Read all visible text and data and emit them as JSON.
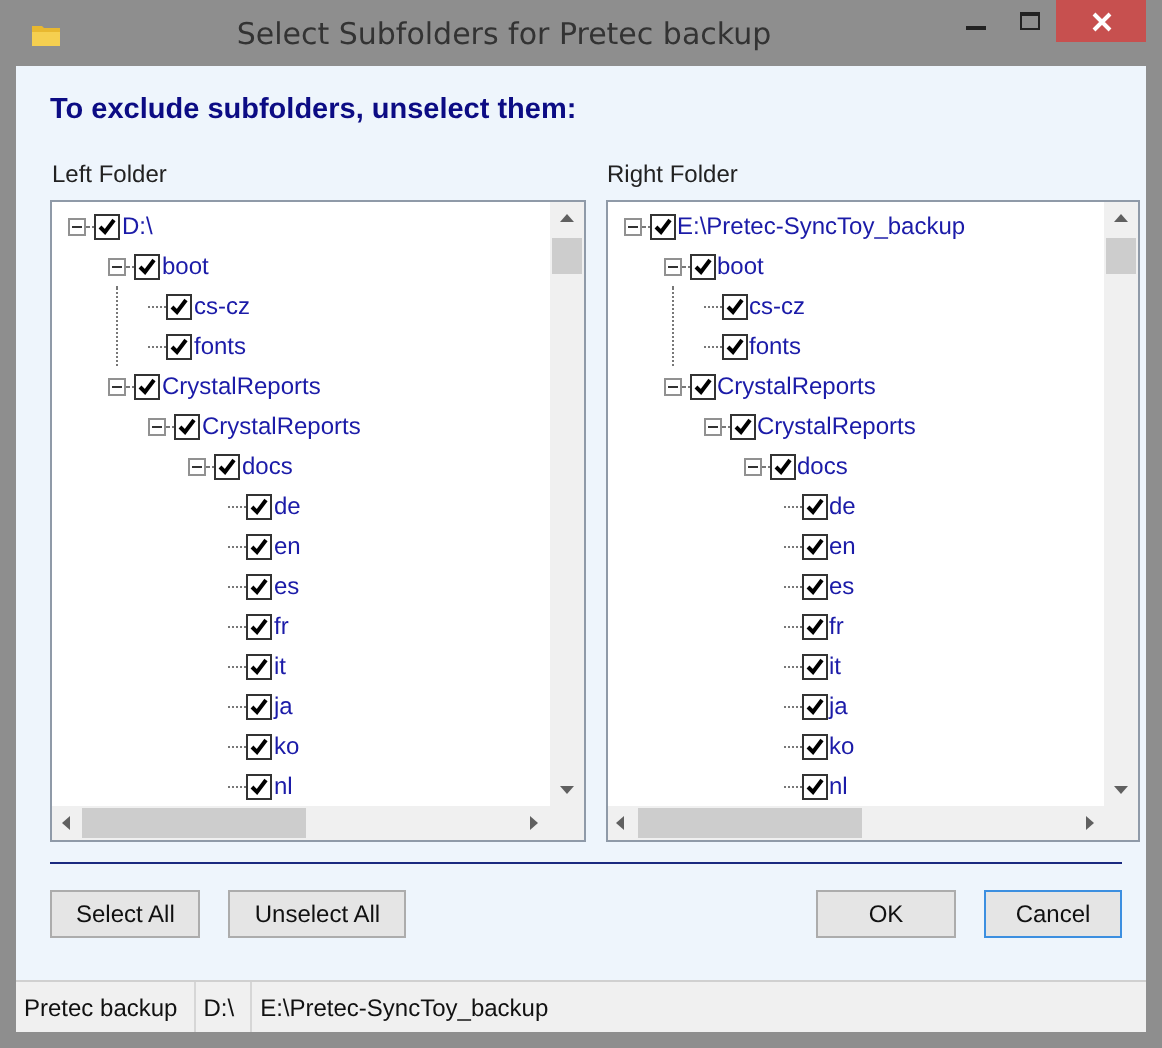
{
  "window": {
    "title": "Select Subfolders for Pretec backup"
  },
  "instruction": "To exclude subfolders, unselect them:",
  "panels": [
    {
      "label": "Left Folder",
      "tree": [
        {
          "name": "D:\\",
          "checked": true,
          "expanded": true,
          "children": [
            {
              "name": "boot",
              "checked": true,
              "expanded": true,
              "children": [
                {
                  "name": "cs-cz",
                  "checked": true
                },
                {
                  "name": "fonts",
                  "checked": true
                }
              ]
            },
            {
              "name": "CrystalReports",
              "checked": true,
              "expanded": true,
              "children": [
                {
                  "name": "CrystalReports",
                  "checked": true,
                  "expanded": true,
                  "children": [
                    {
                      "name": "docs",
                      "checked": true,
                      "expanded": true,
                      "children": [
                        {
                          "name": "de",
                          "checked": true
                        },
                        {
                          "name": "en",
                          "checked": true
                        },
                        {
                          "name": "es",
                          "checked": true
                        },
                        {
                          "name": "fr",
                          "checked": true
                        },
                        {
                          "name": "it",
                          "checked": true
                        },
                        {
                          "name": "ja",
                          "checked": true
                        },
                        {
                          "name": "ko",
                          "checked": true
                        },
                        {
                          "name": "nl",
                          "checked": true
                        }
                      ]
                    }
                  ]
                }
              ]
            }
          ]
        }
      ]
    },
    {
      "label": "Right Folder",
      "tree": [
        {
          "name": "E:\\Pretec-SyncToy_backup",
          "checked": true,
          "expanded": true,
          "children": [
            {
              "name": "boot",
              "checked": true,
              "expanded": true,
              "children": [
                {
                  "name": "cs-cz",
                  "checked": true
                },
                {
                  "name": "fonts",
                  "checked": true
                }
              ]
            },
            {
              "name": "CrystalReports",
              "checked": true,
              "expanded": true,
              "children": [
                {
                  "name": "CrystalReports",
                  "checked": true,
                  "expanded": true,
                  "children": [
                    {
                      "name": "docs",
                      "checked": true,
                      "expanded": true,
                      "children": [
                        {
                          "name": "de",
                          "checked": true
                        },
                        {
                          "name": "en",
                          "checked": true
                        },
                        {
                          "name": "es",
                          "checked": true
                        },
                        {
                          "name": "fr",
                          "checked": true
                        },
                        {
                          "name": "it",
                          "checked": true
                        },
                        {
                          "name": "ja",
                          "checked": true
                        },
                        {
                          "name": "ko",
                          "checked": true
                        },
                        {
                          "name": "nl",
                          "checked": true
                        }
                      ]
                    }
                  ]
                }
              ]
            }
          ]
        }
      ]
    }
  ],
  "left_buttons": [
    {
      "label": "Select All",
      "focused": false
    },
    {
      "label": "Unselect All",
      "focused": false
    }
  ],
  "right_buttons": [
    {
      "label": "OK",
      "focused": false
    },
    {
      "label": "Cancel",
      "focused": true
    }
  ],
  "status_bar": [
    "Pretec backup",
    "D:\\",
    "E:\\Pretec-SyncToy_backup"
  ]
}
